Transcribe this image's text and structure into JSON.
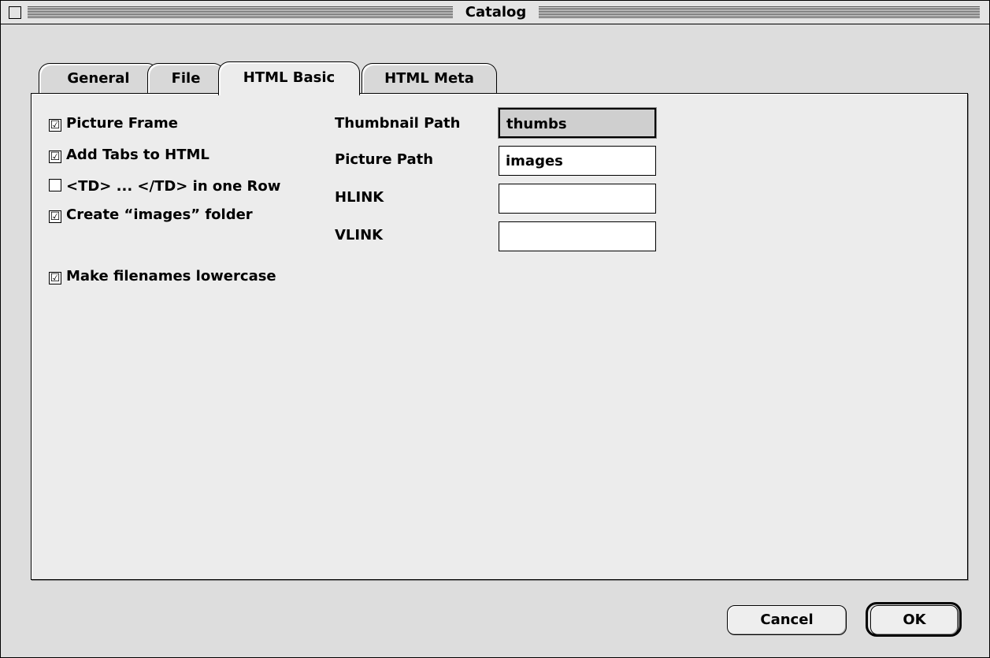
{
  "window": {
    "title": "Catalog"
  },
  "tabs": [
    {
      "label": "General",
      "active": false
    },
    {
      "label": "File",
      "active": false
    },
    {
      "label": "HTML Basic",
      "active": true
    },
    {
      "label": "HTML Meta",
      "active": false
    }
  ],
  "checkboxes": [
    {
      "label": "Picture Frame",
      "checked": true,
      "mark": "☑"
    },
    {
      "label": "Add Tabs to HTML",
      "checked": true,
      "mark": "☑"
    },
    {
      "label": "<TD> ... </TD> in one Row",
      "checked": false,
      "mark": ""
    },
    {
      "label": "Create “images” folder",
      "checked": true,
      "mark": "☑"
    },
    {
      "label": "Make filenames lowercase",
      "checked": true,
      "mark": "☑"
    }
  ],
  "fields": [
    {
      "label": "Thumbnail Path",
      "value": "thumbs"
    },
    {
      "label": "Picture Path",
      "value": "images"
    },
    {
      "label": "HLINK",
      "value": ""
    },
    {
      "label": "VLINK",
      "value": ""
    }
  ],
  "buttons": {
    "cancel": "Cancel",
    "ok": "OK"
  }
}
